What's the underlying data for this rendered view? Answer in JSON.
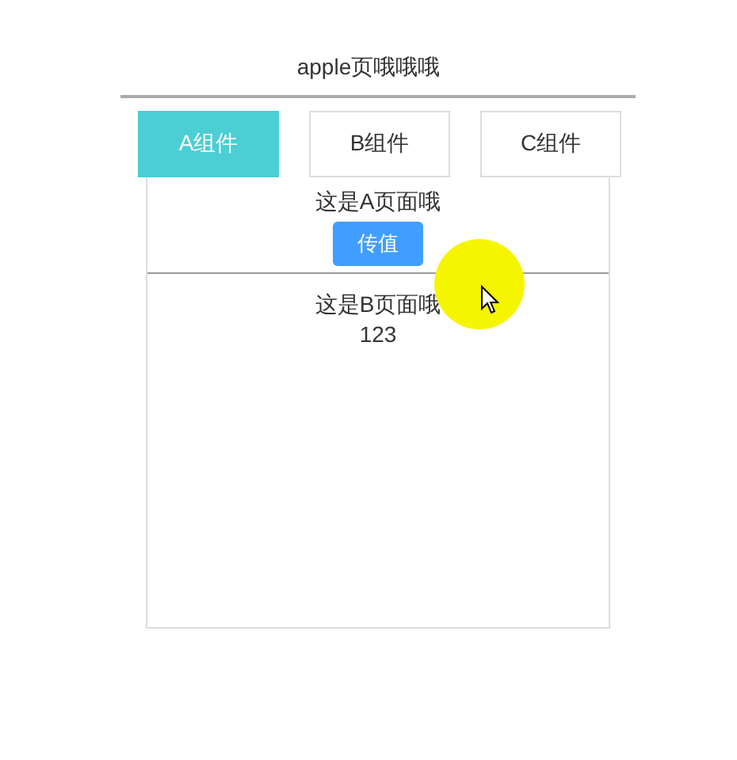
{
  "header": {
    "title": "apple页哦哦哦"
  },
  "tabs": [
    {
      "label": "A组件",
      "selected": true
    },
    {
      "label": "B组件",
      "selected": false
    },
    {
      "label": "C组件",
      "selected": false
    }
  ],
  "page_a": {
    "text": "这是A页面哦",
    "button": "传值"
  },
  "page_b": {
    "text": "这是B页面哦",
    "value": "123"
  }
}
